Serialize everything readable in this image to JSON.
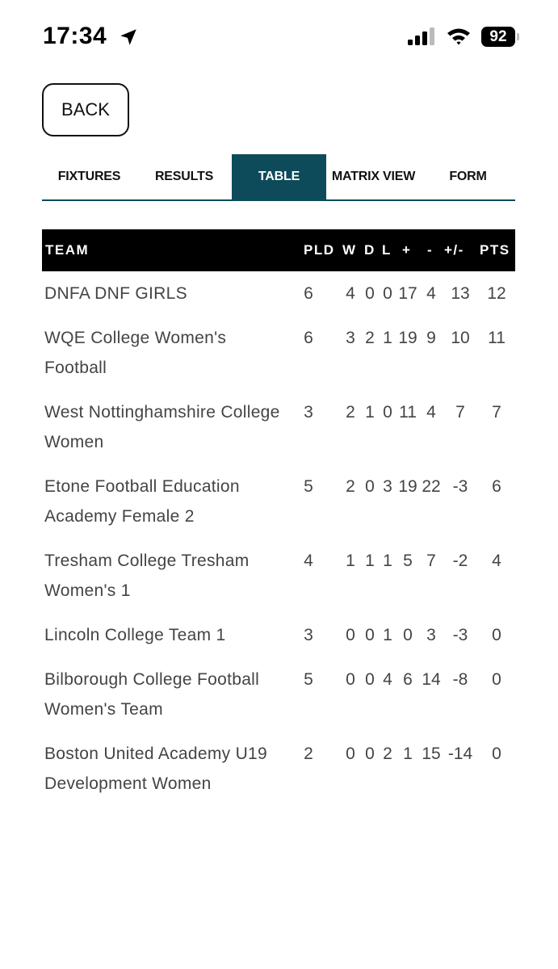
{
  "status_bar": {
    "time": "17:34",
    "battery": "92"
  },
  "back_button": {
    "label": "BACK"
  },
  "tabs": [
    {
      "label": "FIXTURES",
      "active": false
    },
    {
      "label": "RESULTS",
      "active": false
    },
    {
      "label": "TABLE",
      "active": true
    },
    {
      "label": "MATRIX VIEW",
      "active": false
    },
    {
      "label": "FORM",
      "active": false
    }
  ],
  "table": {
    "headers": [
      "TEAM",
      "PLD",
      "W",
      "D",
      "L",
      "+",
      "-",
      "+/-",
      "PTS"
    ],
    "rows": [
      {
        "team": "DNFA DNF GIRLS",
        "pld": "6",
        "w": "4",
        "d": "0",
        "l": "0",
        "gf": "17",
        "ga": "4",
        "gd": "13",
        "pts": "12"
      },
      {
        "team": "WQE College Women's Football",
        "pld": "6",
        "w": "3",
        "d": "2",
        "l": "1",
        "gf": "19",
        "ga": "9",
        "gd": "10",
        "pts": "11"
      },
      {
        "team": "West Nottinghamshire College Women",
        "pld": "3",
        "w": "2",
        "d": "1",
        "l": "0",
        "gf": "11",
        "ga": "4",
        "gd": "7",
        "pts": "7"
      },
      {
        "team": "Etone Football Education Academy Female 2",
        "pld": "5",
        "w": "2",
        "d": "0",
        "l": "3",
        "gf": "19",
        "ga": "22",
        "gd": "-3",
        "pts": "6"
      },
      {
        "team": "Tresham College Tresham Women's 1",
        "pld": "4",
        "w": "1",
        "d": "1",
        "l": "1",
        "gf": "5",
        "ga": "7",
        "gd": "-2",
        "pts": "4"
      },
      {
        "team": "Lincoln College Team 1",
        "pld": "3",
        "w": "0",
        "d": "0",
        "l": "1",
        "gf": "0",
        "ga": "3",
        "gd": "-3",
        "pts": "0"
      },
      {
        "team": "Bilborough College Football Women's Team",
        "pld": "5",
        "w": "0",
        "d": "0",
        "l": "4",
        "gf": "6",
        "ga": "14",
        "gd": "-8",
        "pts": "0"
      },
      {
        "team": "Boston United Academy U19 Development Women",
        "pld": "2",
        "w": "0",
        "d": "0",
        "l": "2",
        "gf": "1",
        "ga": "15",
        "gd": "-14",
        "pts": "0"
      }
    ]
  }
}
